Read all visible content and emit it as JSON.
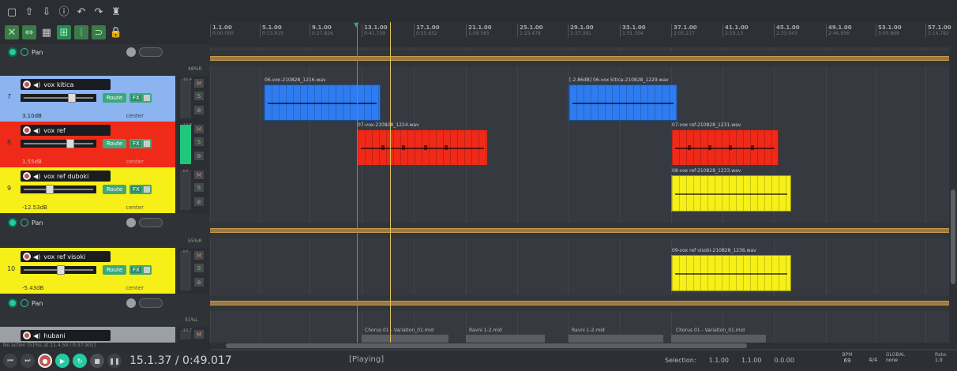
{
  "toolbar": {
    "row1": [
      "new-file",
      "save-in",
      "save-out",
      "info",
      "undo",
      "redo",
      "metronome"
    ],
    "row2": [
      "crossfade",
      "ripple",
      "grid",
      "snap",
      "markers",
      "lock"
    ]
  },
  "envelopes": [
    {
      "label": "Pan"
    },
    {
      "label": "Pan"
    },
    {
      "label": "Pan"
    }
  ],
  "tracks": [
    {
      "number": "7",
      "name": "vox kitica",
      "vol": "3.10dB",
      "pan": "center",
      "color": "#8cb4f0",
      "peak": "-16.4",
      "pctlabel": "48%R"
    },
    {
      "number": "8",
      "name": "vox ref",
      "vol": "1.55dB",
      "pan": "center",
      "color": "#ef2a18",
      "peak": "-12.8"
    },
    {
      "number": "9",
      "name": "vox ref duboki",
      "vol": "-12.53dB",
      "pan": "center",
      "color": "#f6ef18",
      "peak": "-inf"
    },
    {
      "number": "10",
      "name": "vox ref visoki",
      "vol": "-5.43dB",
      "pan": "center",
      "color": "#f6ef18",
      "peak": "-inf",
      "pctlabel": "55%R"
    },
    {
      "number": "",
      "name": "hubani",
      "vol": "",
      "pan": "",
      "color": "#9aa0a6",
      "peak": "-10.7",
      "pctlabel": "51%L"
    }
  ],
  "buttons": {
    "route": "Route",
    "fx": "FX",
    "m": "M",
    "s": "S"
  },
  "status": "No action [51%L at 11.4.59 / 0:37.901]",
  "ruler": [
    {
      "bar": "1.1.00",
      "time": "0:00.000"
    },
    {
      "bar": "5.1.00",
      "time": "0:13.915"
    },
    {
      "bar": "9.1.00",
      "time": "0:27.826"
    },
    {
      "bar": "13.1.00",
      "time": "0:41.739"
    },
    {
      "bar": "17.1.00",
      "time": "0:55.652"
    },
    {
      "bar": "21.1.00",
      "time": "1:09.565"
    },
    {
      "bar": "25.1.00",
      "time": "1:23.478"
    },
    {
      "bar": "29.1.00",
      "time": "1:37.391"
    },
    {
      "bar": "33.1.00",
      "time": "1:51.304"
    },
    {
      "bar": "37.1.00",
      "time": "2:05.217"
    },
    {
      "bar": "41.1.00",
      "time": "2:19.13"
    },
    {
      "bar": "45.1.00",
      "time": "2:33.043"
    },
    {
      "bar": "49.1.00",
      "time": "2:46.956"
    },
    {
      "bar": "53.1.00",
      "time": "3:00.869"
    },
    {
      "bar": "57.1.00",
      "time": "3:14.782"
    }
  ],
  "items": {
    "a1": "06-vox-210828_1216.wav",
    "a2": "[-2.86dB] 06-vox kitica-210828_1229.wav",
    "b1": "07-vox-210828_1224.wav",
    "b2": "07-vox ref-210828_1231.wav",
    "c1": "08-vox ref-210828_1233.wav",
    "d1": "09-vox ref visoki-210828_1236.wav",
    "m1": "Chorus 01 - Variation_01.mid",
    "m2": "Ravni 1-2.mid",
    "m3": "Ravni 1-2.mid",
    "m4": "Chorus 01 - Variation_01.mid"
  },
  "transport": {
    "time": "15.1.37 / 0:49.017",
    "state": "[Playing]",
    "selection_label": "Selection:",
    "sel_start": "1.1.00",
    "sel_end": "1.1.00",
    "sel_len": "0.0.00",
    "bpm_label": "BPM",
    "bpm": "69",
    "timesig": "4/4",
    "global_label": "GLOBAL",
    "global_val": "none",
    "rate_label": "Rate:",
    "rate": "1.0"
  }
}
